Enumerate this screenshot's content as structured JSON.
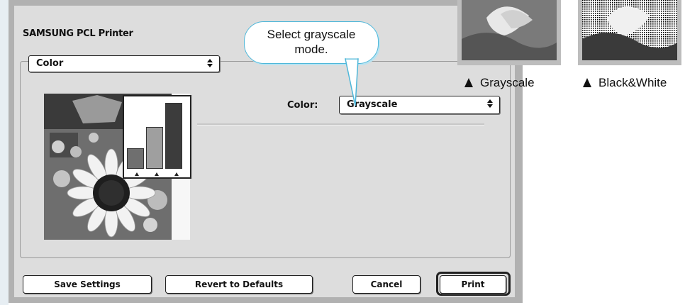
{
  "dialog": {
    "printer_name": "SAMSUNG PCL Printer",
    "panel_select": "Color",
    "color_label": "Color:",
    "color_value": "Grayscale",
    "buttons": {
      "save": "Save Settings",
      "revert": "Revert to Defaults",
      "cancel": "Cancel",
      "print": "Print"
    }
  },
  "callout": {
    "line1": "Select grayscale",
    "line2": "mode."
  },
  "thumbnails": [
    {
      "caption": "Grayscale"
    },
    {
      "caption": "Black&White"
    }
  ],
  "preview_chart": {
    "bar_levels": [
      0.3,
      0.6,
      0.95
    ],
    "bar_colors": [
      "#6f6f6f",
      "#9f9f9f",
      "#3c3c3c"
    ]
  },
  "colors": {
    "dialog_bg": "#dddddd",
    "dialog_frame": "#b1b1b1",
    "callout_border": "#4fb7d9",
    "side_strip": "#e7eef3"
  }
}
